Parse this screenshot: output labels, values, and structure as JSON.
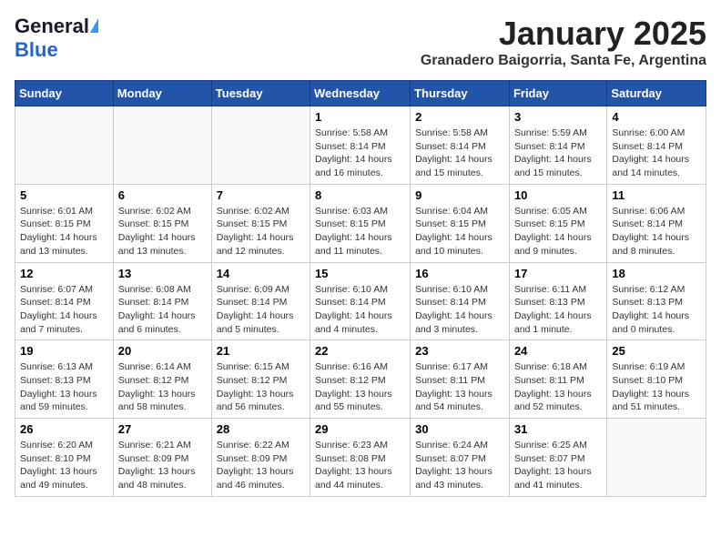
{
  "header": {
    "logo_general": "General",
    "logo_blue": "Blue",
    "month_title": "January 2025",
    "location": "Granadero Baigorria, Santa Fe, Argentina"
  },
  "weekdays": [
    "Sunday",
    "Monday",
    "Tuesday",
    "Wednesday",
    "Thursday",
    "Friday",
    "Saturday"
  ],
  "weeks": [
    [
      {
        "day": "",
        "info": ""
      },
      {
        "day": "",
        "info": ""
      },
      {
        "day": "",
        "info": ""
      },
      {
        "day": "1",
        "info": "Sunrise: 5:58 AM\nSunset: 8:14 PM\nDaylight: 14 hours and 16 minutes."
      },
      {
        "day": "2",
        "info": "Sunrise: 5:58 AM\nSunset: 8:14 PM\nDaylight: 14 hours and 15 minutes."
      },
      {
        "day": "3",
        "info": "Sunrise: 5:59 AM\nSunset: 8:14 PM\nDaylight: 14 hours and 15 minutes."
      },
      {
        "day": "4",
        "info": "Sunrise: 6:00 AM\nSunset: 8:14 PM\nDaylight: 14 hours and 14 minutes."
      }
    ],
    [
      {
        "day": "5",
        "info": "Sunrise: 6:01 AM\nSunset: 8:15 PM\nDaylight: 14 hours and 13 minutes."
      },
      {
        "day": "6",
        "info": "Sunrise: 6:02 AM\nSunset: 8:15 PM\nDaylight: 14 hours and 13 minutes."
      },
      {
        "day": "7",
        "info": "Sunrise: 6:02 AM\nSunset: 8:15 PM\nDaylight: 14 hours and 12 minutes."
      },
      {
        "day": "8",
        "info": "Sunrise: 6:03 AM\nSunset: 8:15 PM\nDaylight: 14 hours and 11 minutes."
      },
      {
        "day": "9",
        "info": "Sunrise: 6:04 AM\nSunset: 8:15 PM\nDaylight: 14 hours and 10 minutes."
      },
      {
        "day": "10",
        "info": "Sunrise: 6:05 AM\nSunset: 8:15 PM\nDaylight: 14 hours and 9 minutes."
      },
      {
        "day": "11",
        "info": "Sunrise: 6:06 AM\nSunset: 8:14 PM\nDaylight: 14 hours and 8 minutes."
      }
    ],
    [
      {
        "day": "12",
        "info": "Sunrise: 6:07 AM\nSunset: 8:14 PM\nDaylight: 14 hours and 7 minutes."
      },
      {
        "day": "13",
        "info": "Sunrise: 6:08 AM\nSunset: 8:14 PM\nDaylight: 14 hours and 6 minutes."
      },
      {
        "day": "14",
        "info": "Sunrise: 6:09 AM\nSunset: 8:14 PM\nDaylight: 14 hours and 5 minutes."
      },
      {
        "day": "15",
        "info": "Sunrise: 6:10 AM\nSunset: 8:14 PM\nDaylight: 14 hours and 4 minutes."
      },
      {
        "day": "16",
        "info": "Sunrise: 6:10 AM\nSunset: 8:14 PM\nDaylight: 14 hours and 3 minutes."
      },
      {
        "day": "17",
        "info": "Sunrise: 6:11 AM\nSunset: 8:13 PM\nDaylight: 14 hours and 1 minute."
      },
      {
        "day": "18",
        "info": "Sunrise: 6:12 AM\nSunset: 8:13 PM\nDaylight: 14 hours and 0 minutes."
      }
    ],
    [
      {
        "day": "19",
        "info": "Sunrise: 6:13 AM\nSunset: 8:13 PM\nDaylight: 13 hours and 59 minutes."
      },
      {
        "day": "20",
        "info": "Sunrise: 6:14 AM\nSunset: 8:12 PM\nDaylight: 13 hours and 58 minutes."
      },
      {
        "day": "21",
        "info": "Sunrise: 6:15 AM\nSunset: 8:12 PM\nDaylight: 13 hours and 56 minutes."
      },
      {
        "day": "22",
        "info": "Sunrise: 6:16 AM\nSunset: 8:12 PM\nDaylight: 13 hours and 55 minutes."
      },
      {
        "day": "23",
        "info": "Sunrise: 6:17 AM\nSunset: 8:11 PM\nDaylight: 13 hours and 54 minutes."
      },
      {
        "day": "24",
        "info": "Sunrise: 6:18 AM\nSunset: 8:11 PM\nDaylight: 13 hours and 52 minutes."
      },
      {
        "day": "25",
        "info": "Sunrise: 6:19 AM\nSunset: 8:10 PM\nDaylight: 13 hours and 51 minutes."
      }
    ],
    [
      {
        "day": "26",
        "info": "Sunrise: 6:20 AM\nSunset: 8:10 PM\nDaylight: 13 hours and 49 minutes."
      },
      {
        "day": "27",
        "info": "Sunrise: 6:21 AM\nSunset: 8:09 PM\nDaylight: 13 hours and 48 minutes."
      },
      {
        "day": "28",
        "info": "Sunrise: 6:22 AM\nSunset: 8:09 PM\nDaylight: 13 hours and 46 minutes."
      },
      {
        "day": "29",
        "info": "Sunrise: 6:23 AM\nSunset: 8:08 PM\nDaylight: 13 hours and 44 minutes."
      },
      {
        "day": "30",
        "info": "Sunrise: 6:24 AM\nSunset: 8:07 PM\nDaylight: 13 hours and 43 minutes."
      },
      {
        "day": "31",
        "info": "Sunrise: 6:25 AM\nSunset: 8:07 PM\nDaylight: 13 hours and 41 minutes."
      },
      {
        "day": "",
        "info": ""
      }
    ]
  ]
}
